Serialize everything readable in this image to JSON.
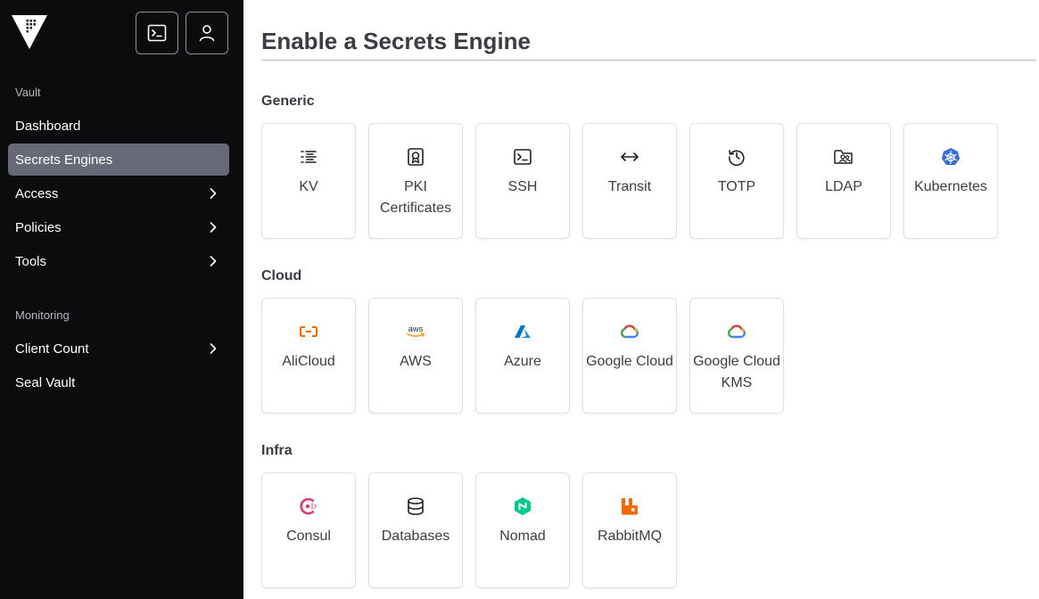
{
  "sidebar": {
    "sections": [
      {
        "label": "Vault",
        "items": [
          {
            "label": "Dashboard",
            "active": false,
            "has_chevron": false
          },
          {
            "label": "Secrets Engines",
            "active": true,
            "has_chevron": false
          },
          {
            "label": "Access",
            "active": false,
            "has_chevron": true
          },
          {
            "label": "Policies",
            "active": false,
            "has_chevron": true
          },
          {
            "label": "Tools",
            "active": false,
            "has_chevron": true
          }
        ]
      },
      {
        "label": "Monitoring",
        "items": [
          {
            "label": "Client Count",
            "active": false,
            "has_chevron": true
          },
          {
            "label": "Seal Vault",
            "active": false,
            "has_chevron": false
          }
        ]
      }
    ],
    "top_buttons": [
      {
        "icon": "terminal-icon"
      },
      {
        "icon": "user-icon"
      }
    ]
  },
  "main": {
    "title": "Enable a Secrets Engine",
    "groups": [
      {
        "label": "Generic",
        "engines": [
          {
            "label": "KV",
            "icon": "list-icon"
          },
          {
            "label": "PKI Certificates",
            "icon": "certificate-icon"
          },
          {
            "label": "SSH",
            "icon": "terminal-icon"
          },
          {
            "label": "Transit",
            "icon": "swap-arrows-icon"
          },
          {
            "label": "TOTP",
            "icon": "history-icon"
          },
          {
            "label": "LDAP",
            "icon": "folder-users-icon"
          },
          {
            "label": "Kubernetes",
            "icon": "kubernetes-icon"
          }
        ]
      },
      {
        "label": "Cloud",
        "engines": [
          {
            "label": "AliCloud",
            "icon": "alicloud-icon"
          },
          {
            "label": "AWS",
            "icon": "aws-icon"
          },
          {
            "label": "Azure",
            "icon": "azure-icon"
          },
          {
            "label": "Google Cloud",
            "icon": "google-cloud-icon"
          },
          {
            "label": "Google Cloud KMS",
            "icon": "google-cloud-icon"
          }
        ]
      },
      {
        "label": "Infra",
        "engines": [
          {
            "label": "Consul",
            "icon": "consul-icon"
          },
          {
            "label": "Databases",
            "icon": "database-icon"
          },
          {
            "label": "Nomad",
            "icon": "nomad-icon"
          },
          {
            "label": "RabbitMQ",
            "icon": "rabbitmq-icon"
          }
        ]
      }
    ]
  },
  "colors": {
    "sidebar_bg": "#0c0c0e",
    "active_item_bg": "#656a76",
    "alicloud_orange": "#ff6a00",
    "azure_blue": "#0078d4",
    "kubernetes_blue": "#326ce5",
    "consul_pink": "#e03875",
    "nomad_green": "#00ca8e",
    "rabbitmq_orange": "#ff6600"
  }
}
